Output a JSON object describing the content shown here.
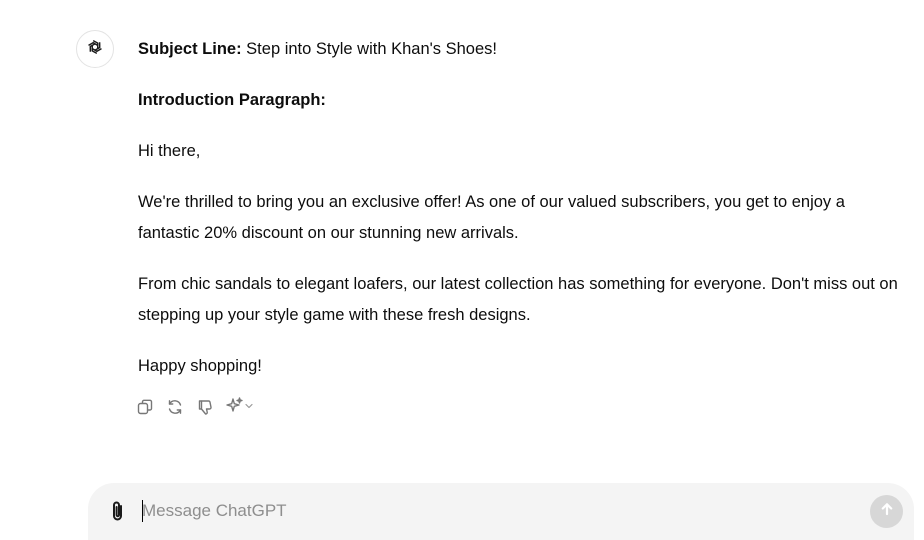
{
  "assistant": {
    "avatar_icon": "openai-logo-icon"
  },
  "message": {
    "subject_label": "Subject Line:",
    "subject_text": " Step into Style with Khan's Shoes!",
    "intro_label": "Introduction Paragraph:",
    "greeting": "Hi there,",
    "paragraph1": "We're thrilled to bring you an exclusive offer! As one of our valued subscribers, you get to enjoy a fantastic 20% discount on our stunning new arrivals.",
    "paragraph2": "From chic sandals to elegant loafers, our latest collection has something for everyone. Don't miss out on stepping up your style game with these fresh designs.",
    "closing": "Happy shopping!"
  },
  "actions": {
    "icons": [
      "copy-icon",
      "regenerate-icon",
      "thumbs-down-icon",
      "sparkle-model-icon",
      "chevron-down-icon"
    ]
  },
  "composer": {
    "placeholder": "Message ChatGPT",
    "value": "",
    "attach_icon": "paperclip-icon",
    "send_icon": "arrow-up-icon"
  }
}
